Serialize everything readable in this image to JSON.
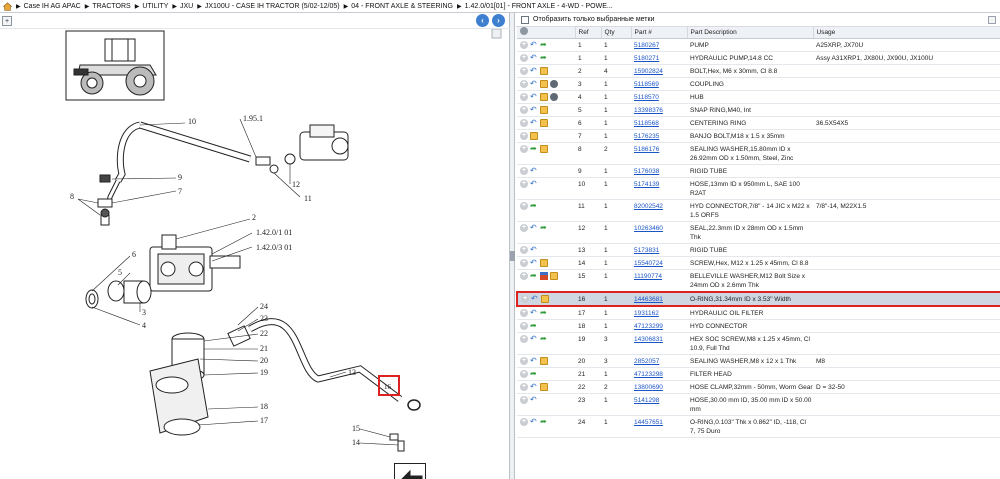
{
  "breadcrumb": [
    "Case IH AG APAC",
    "TRACTORS",
    "UTILITY",
    "JXU",
    "JX100U - CASE IH TRACTOR (5/02-12/05)",
    "04 - FRONT AXLE & STEERING",
    "1.42.0/01[01] - FRONT AXLE - 4-WD - POWE..."
  ],
  "diagram": {
    "callouts": [
      "10",
      "1.95.1",
      "9",
      "7",
      "8",
      "6",
      "2",
      "1.42.0/1 01",
      "1.42.0/3 01",
      "12",
      "11",
      "5",
      "3",
      "4",
      "24",
      "23",
      "22",
      "21",
      "20",
      "19",
      "18",
      "17",
      "13",
      "16",
      "15",
      "14"
    ],
    "highlighted_callout": "16"
  },
  "filter": {
    "label": "Отобразить только выбранные метки",
    "checked": false
  },
  "table": {
    "headers": [
      "Ref",
      "Qty",
      "Part #",
      "Part Description",
      "Usage"
    ],
    "rows": [
      {
        "ref": "1",
        "qty": "1",
        "part": "5180267",
        "desc": "PUMP",
        "usage": "A25XRP, JX70U",
        "icons": [
          "plus",
          "undo",
          "go"
        ]
      },
      {
        "ref": "1",
        "qty": "1",
        "part": "5180271",
        "desc": "HYDRAULIC PUMP,14.8 CC",
        "usage": "Assy A31XRP1, JX80U, JX90U, JX100U",
        "icons": [
          "plus",
          "undo",
          "go"
        ]
      },
      {
        "ref": "2",
        "qty": "4",
        "part": "15902824",
        "desc": "BOLT,Hex, M6 x 30mm, Cl 8.8",
        "usage": "",
        "icons": [
          "plus",
          "undo",
          "box"
        ]
      },
      {
        "ref": "3",
        "qty": "1",
        "part": "5118569",
        "desc": "COUPLING",
        "usage": "",
        "icons": [
          "plus",
          "undo",
          "box",
          "gear"
        ]
      },
      {
        "ref": "4",
        "qty": "1",
        "part": "5118570",
        "desc": "HUB",
        "usage": "",
        "icons": [
          "plus",
          "undo",
          "box",
          "gear"
        ]
      },
      {
        "ref": "5",
        "qty": "1",
        "part": "13398376",
        "desc": "SNAP RING,M40, Int",
        "usage": "",
        "icons": [
          "plus",
          "undo",
          "box"
        ]
      },
      {
        "ref": "6",
        "qty": "1",
        "part": "5118568",
        "desc": "CENTERING RING",
        "usage": "36.5X54X5",
        "icons": [
          "plus",
          "undo",
          "box"
        ]
      },
      {
        "ref": "7",
        "qty": "1",
        "part": "5176235",
        "desc": "BANJO BOLT,M18 x 1.5 x 35mm",
        "usage": "",
        "icons": [
          "plus",
          "box"
        ]
      },
      {
        "ref": "8",
        "qty": "2",
        "part": "5186176",
        "desc": "SEALING WASHER,15.80mm ID x 26.92mm OD x 1.50mm, Steel, Zinc",
        "usage": "",
        "icons": [
          "plus",
          "go",
          "box"
        ]
      },
      {
        "ref": "9",
        "qty": "1",
        "part": "5176038",
        "desc": "RIGID TUBE",
        "usage": "",
        "icons": [
          "plus",
          "undo"
        ]
      },
      {
        "ref": "10",
        "qty": "1",
        "part": "5174139",
        "desc": "HOSE,13mm ID x 950mm L, SAE 100 R2AT",
        "usage": "",
        "icons": [
          "plus",
          "undo"
        ]
      },
      {
        "ref": "11",
        "qty": "1",
        "part": "82002542",
        "desc": "HYD CONNECTOR,7/8\" - 14 JIC x M22 x 1.5 ORFS",
        "usage": "7/8\"-14, M22X1.5",
        "icons": [
          "plus",
          "go"
        ]
      },
      {
        "ref": "12",
        "qty": "1",
        "part": "10263460",
        "desc": "SEAL,22.3mm ID x 28mm OD x 1.5mm Thk",
        "usage": "",
        "icons": [
          "plus",
          "undo",
          "go"
        ]
      },
      {
        "ref": "13",
        "qty": "1",
        "part": "5173831",
        "desc": "RIGID TUBE",
        "usage": "",
        "icons": [
          "plus",
          "undo"
        ]
      },
      {
        "ref": "14",
        "qty": "1",
        "part": "15540724",
        "desc": "SCREW,Hex, M12 x 1.25 x 45mm, Cl 8.8",
        "usage": "",
        "icons": [
          "plus",
          "undo",
          "box"
        ]
      },
      {
        "ref": "15",
        "qty": "1",
        "part": "11190774",
        "desc": "BELLEVILLE WASHER,M12 Bolt Size x 24mm OD x 2.6mm Thk",
        "usage": "",
        "icons": [
          "plus",
          "go",
          "flag",
          "box"
        ]
      },
      {
        "ref": "16",
        "qty": "1",
        "part": "14463681",
        "desc": "O-RING,31.34mm ID x 3.53\" Width",
        "usage": "",
        "icons": [
          "plus",
          "undo",
          "box"
        ],
        "selected": true
      },
      {
        "ref": "17",
        "qty": "1",
        "part": "1931162",
        "desc": "HYDRAULIC OIL FILTER",
        "usage": "",
        "icons": [
          "plus",
          "undo",
          "go"
        ]
      },
      {
        "ref": "18",
        "qty": "1",
        "part": "47123299",
        "desc": "HYD CONNECTOR",
        "usage": "",
        "icons": [
          "plus",
          "go"
        ]
      },
      {
        "ref": "19",
        "qty": "3",
        "part": "14306831",
        "desc": "HEX SOC SCREW,M8 x 1.25 x 45mm, Cl 10.9, Full Thd",
        "usage": "",
        "icons": [
          "plus",
          "undo",
          "go"
        ]
      },
      {
        "ref": "20",
        "qty": "3",
        "part": "2852057",
        "desc": "SEALING WASHER,M8 x 12 x 1 Thk",
        "usage": "M8",
        "icons": [
          "plus",
          "undo",
          "box"
        ]
      },
      {
        "ref": "21",
        "qty": "1",
        "part": "47123298",
        "desc": "FILTER HEAD",
        "usage": "",
        "icons": [
          "plus",
          "go"
        ]
      },
      {
        "ref": "22",
        "qty": "2",
        "part": "13800690",
        "desc": "HOSE CLAMP,32mm - 50mm, Worm Gear",
        "usage": "D = 32-50",
        "icons": [
          "plus",
          "undo",
          "box"
        ]
      },
      {
        "ref": "23",
        "qty": "1",
        "part": "5141298",
        "desc": "HOSE,30.00 mm ID, 35.00 mm ID x 50.00 mm",
        "usage": "",
        "icons": [
          "plus",
          "undo"
        ]
      },
      {
        "ref": "24",
        "qty": "1",
        "part": "14457651",
        "desc": "O-RING,0.103\" Thk x 0.862\" ID, -118, Cl 7, 75 Duro",
        "usage": "",
        "icons": [
          "plus",
          "undo",
          "go"
        ]
      }
    ]
  },
  "colors": {
    "link": "#1a55c8",
    "highlight": "#dd2222",
    "selected_row": "#cfd7e2",
    "nav_button": "#3f7fd0"
  }
}
